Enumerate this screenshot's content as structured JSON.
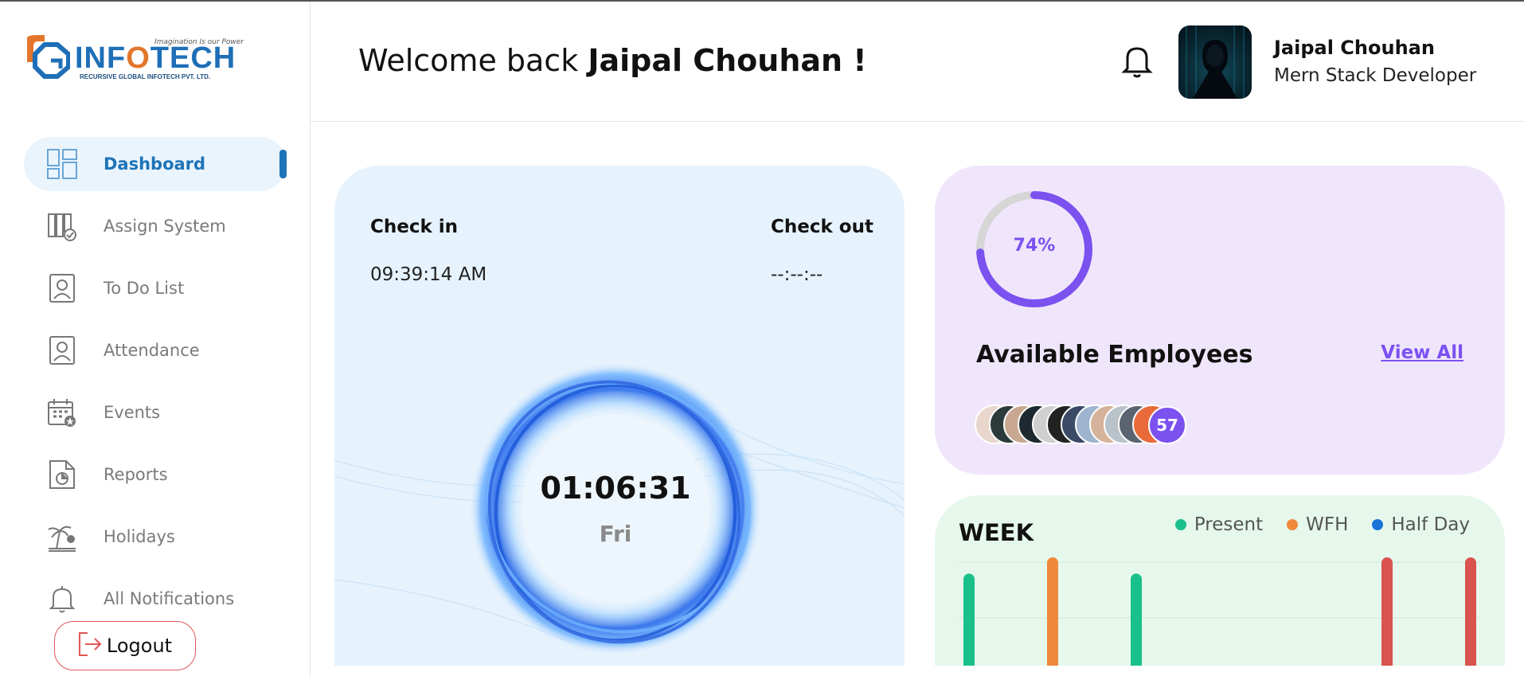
{
  "brand": {
    "tagline": "Imagination Is our Power",
    "name_part1": "INF",
    "name_o": "O",
    "name_part2": "TECH",
    "company": "RECURSIVE GLOBAL INFOTECH PVT. LTD."
  },
  "sidebar": {
    "items": [
      {
        "label": "Dashboard",
        "icon": "dashboard-icon",
        "active": true
      },
      {
        "label": "Assign System",
        "icon": "assign-system-icon"
      },
      {
        "label": "To Do List",
        "icon": "todo-icon"
      },
      {
        "label": "Attendance",
        "icon": "attendance-icon"
      },
      {
        "label": "Events",
        "icon": "calendar-icon"
      },
      {
        "label": "Reports",
        "icon": "report-icon"
      },
      {
        "label": "Holidays",
        "icon": "holiday-icon"
      },
      {
        "label": "All Notifications",
        "icon": "bell-icon"
      }
    ],
    "logout_label": "Logout"
  },
  "header": {
    "welcome_prefix": "Welcome back",
    "welcome_name": "Jaipal Chouhan !",
    "user_name": "Jaipal Chouhan",
    "user_role": "Mern Stack Developer"
  },
  "check": {
    "checkin_label": "Check in",
    "checkin_value": "09:39:14 AM",
    "checkout_label": "Check out",
    "checkout_value": "--:--:--",
    "timer": "01:06:31",
    "day": "Fri"
  },
  "employees": {
    "percent": 74,
    "percent_label": "74%",
    "title": "Available Employees",
    "view_all": "View All",
    "count_label": "57"
  },
  "week": {
    "title": "WEEK",
    "legend": [
      {
        "label": "Present",
        "color": "#19c08a"
      },
      {
        "label": "WFH",
        "color": "#f0883a"
      },
      {
        "label": "Half Day",
        "color": "#1a73d9"
      }
    ],
    "bars": [
      {
        "color": "#19c08a",
        "level": 0.85
      },
      {
        "color": "#f0883a",
        "level": 1.0
      },
      {
        "color": "#19c08a",
        "level": 0.85
      },
      {
        "color": "none",
        "level": 0
      },
      {
        "color": "none",
        "level": 0
      },
      {
        "color": "#d9534f",
        "level": 1.0
      },
      {
        "color": "#d9534f",
        "level": 1.0
      }
    ]
  },
  "colors": {
    "accent": "#1e74b8",
    "purple": "#7b51f0",
    "logout_border": "#e05656"
  }
}
